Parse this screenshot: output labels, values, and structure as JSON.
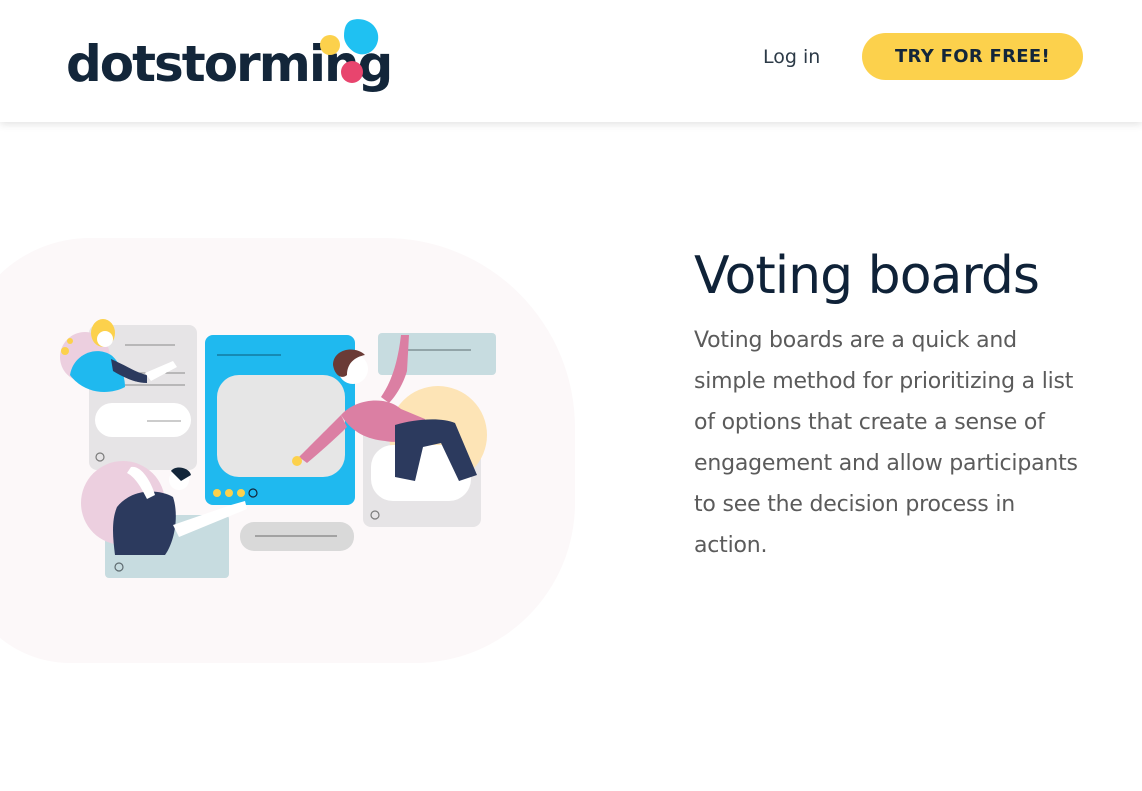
{
  "header": {
    "logo_text": "dotstorming",
    "login_label": "Log in",
    "cta_label": "TRY FOR FREE!"
  },
  "feature": {
    "title": "Voting boards",
    "description": "Voting boards are a quick and simple method for prioritizing a list of options that create a sense of engagement and allow participants to see the decision process in action."
  },
  "colors": {
    "brand_navy": "#13263a",
    "cta_yellow": "#fcd14c",
    "logo_blue": "#1fc1f2",
    "logo_yellow": "#fcd14c",
    "logo_pink": "#e8456e",
    "hero_background": "#fcf8f9",
    "body_text": "#5b5b5b"
  },
  "illustration": {
    "name": "collaboration-voting-illustration"
  }
}
